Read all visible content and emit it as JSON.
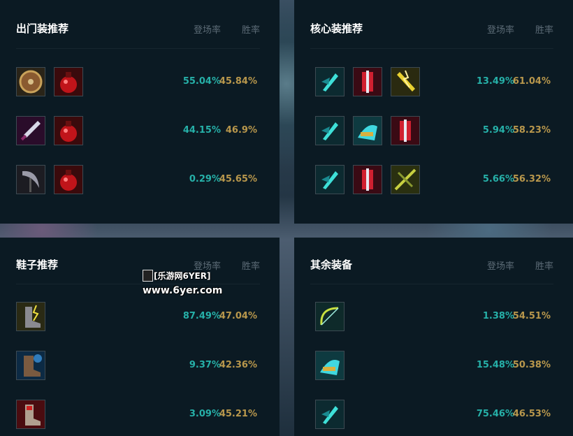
{
  "sections": {
    "starter": {
      "title": "出门装推荐",
      "col_pick": "登场率",
      "col_win": "胜率",
      "rows": [
        {
          "icons": [
            "shield-icon",
            "potion-icon"
          ],
          "pick": "55.04%",
          "win": "45.84%"
        },
        {
          "icons": [
            "dagger-icon",
            "potion-icon"
          ],
          "pick": "44.15%",
          "win": "46.9%"
        },
        {
          "icons": [
            "scythe-icon",
            "potion-icon"
          ],
          "pick": "0.29%",
          "win": "45.65%"
        }
      ]
    },
    "core": {
      "title": "核心装推荐",
      "col_pick": "登场率",
      "col_win": "胜率",
      "rows": [
        {
          "icons": [
            "blade-icon",
            "red-armor-icon",
            "lightning-sword-icon"
          ],
          "pick": "13.49%",
          "win": "61.04%"
        },
        {
          "icons": [
            "blade-icon",
            "gauntlet-icon",
            "red-armor-icon"
          ],
          "pick": "5.94%",
          "win": "58.23%"
        },
        {
          "icons": [
            "blade-icon",
            "red-armor-icon",
            "crossbow-icon"
          ],
          "pick": "5.66%",
          "win": "56.32%"
        }
      ]
    },
    "boots": {
      "title": "鞋子推荐",
      "col_pick": "登场率",
      "col_win": "胜率",
      "rows": [
        {
          "icons": [
            "lightning-boots-icon"
          ],
          "pick": "87.49%",
          "win": "47.04%"
        },
        {
          "icons": [
            "armored-boots-icon"
          ],
          "pick": "9.37%",
          "win": "42.36%"
        },
        {
          "icons": [
            "red-boots-icon"
          ],
          "pick": "3.09%",
          "win": "45.21%"
        }
      ]
    },
    "other": {
      "title": "其余装备",
      "col_pick": "登场率",
      "col_win": "胜率",
      "rows": [
        {
          "icons": [
            "bow-icon"
          ],
          "pick": "1.38%",
          "win": "54.51%"
        },
        {
          "icons": [
            "gauntlet-icon"
          ],
          "pick": "15.48%",
          "win": "50.38%"
        },
        {
          "icons": [
            "blade-icon"
          ],
          "pick": "75.46%",
          "win": "46.53%"
        }
      ]
    }
  },
  "watermark": {
    "line1": "[乐游网6YER]",
    "line2": "www.6yer.com"
  },
  "colors": {
    "pick": "#26b0a8",
    "win": "#b8974c",
    "panel": "#0b1a23"
  }
}
